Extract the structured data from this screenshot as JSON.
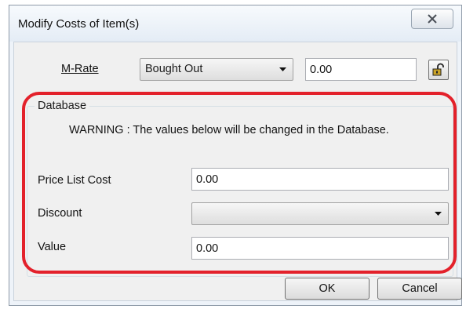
{
  "window": {
    "title": "Modify Costs of Item(s)",
    "close_icon": "close-x-icon"
  },
  "mrate": {
    "label": "M-Rate",
    "selected_option": "Bought Out",
    "value": "0.00",
    "lock_icon": "padlock-unlocked-icon"
  },
  "database": {
    "group_title": "Database",
    "warning": "WARNING : The values below will be changed in the Database.",
    "price_list_cost": {
      "label": "Price List Cost",
      "value": "0.00"
    },
    "discount": {
      "label": "Discount",
      "value": ""
    },
    "value": {
      "label": "Value",
      "value": "0.00"
    }
  },
  "buttons": {
    "ok": "OK",
    "cancel": "Cancel"
  },
  "colors": {
    "highlight": "#e3212b",
    "client_background": "#f0f0f0",
    "titlebar": "#eef3f9"
  }
}
